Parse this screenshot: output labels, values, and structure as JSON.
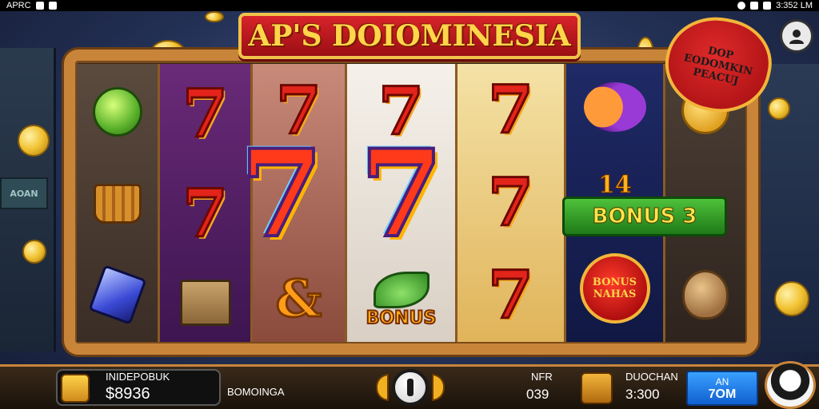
{
  "status_bar": {
    "app_label": "APRC",
    "time": "3:352 LM"
  },
  "title": "AP'S DOIOMINESIA",
  "promo_badge": {
    "lines": [
      "DOP",
      "EODOMKIN",
      "PEACUJ"
    ]
  },
  "reels": {
    "bonus_ribbon": "BONUS 3",
    "bonus_number": "14",
    "bonus_symbol_label": "BONUS",
    "bonus_medal_lines": [
      "BONUS",
      "NAHAS"
    ],
    "seven_symbol": "7",
    "ampersand_symbol": "&"
  },
  "background": {
    "sign_text": "AOAN"
  },
  "bottom_bar": {
    "balance_label": "INIDEPOBUK",
    "balance_value": "$8936",
    "lines_label": "BOMOINGA",
    "bet_label": "NFR",
    "bet_value": "039",
    "win_label": "DUOCHAN",
    "win_value": "3:300",
    "action_button_top": "AN",
    "action_button_bottom": "7OM"
  },
  "colors": {
    "title_banner": "#c11a20",
    "frame": "#c8853a",
    "bonus_green": "#3aa52a",
    "action_blue": "#1f7ae0"
  }
}
